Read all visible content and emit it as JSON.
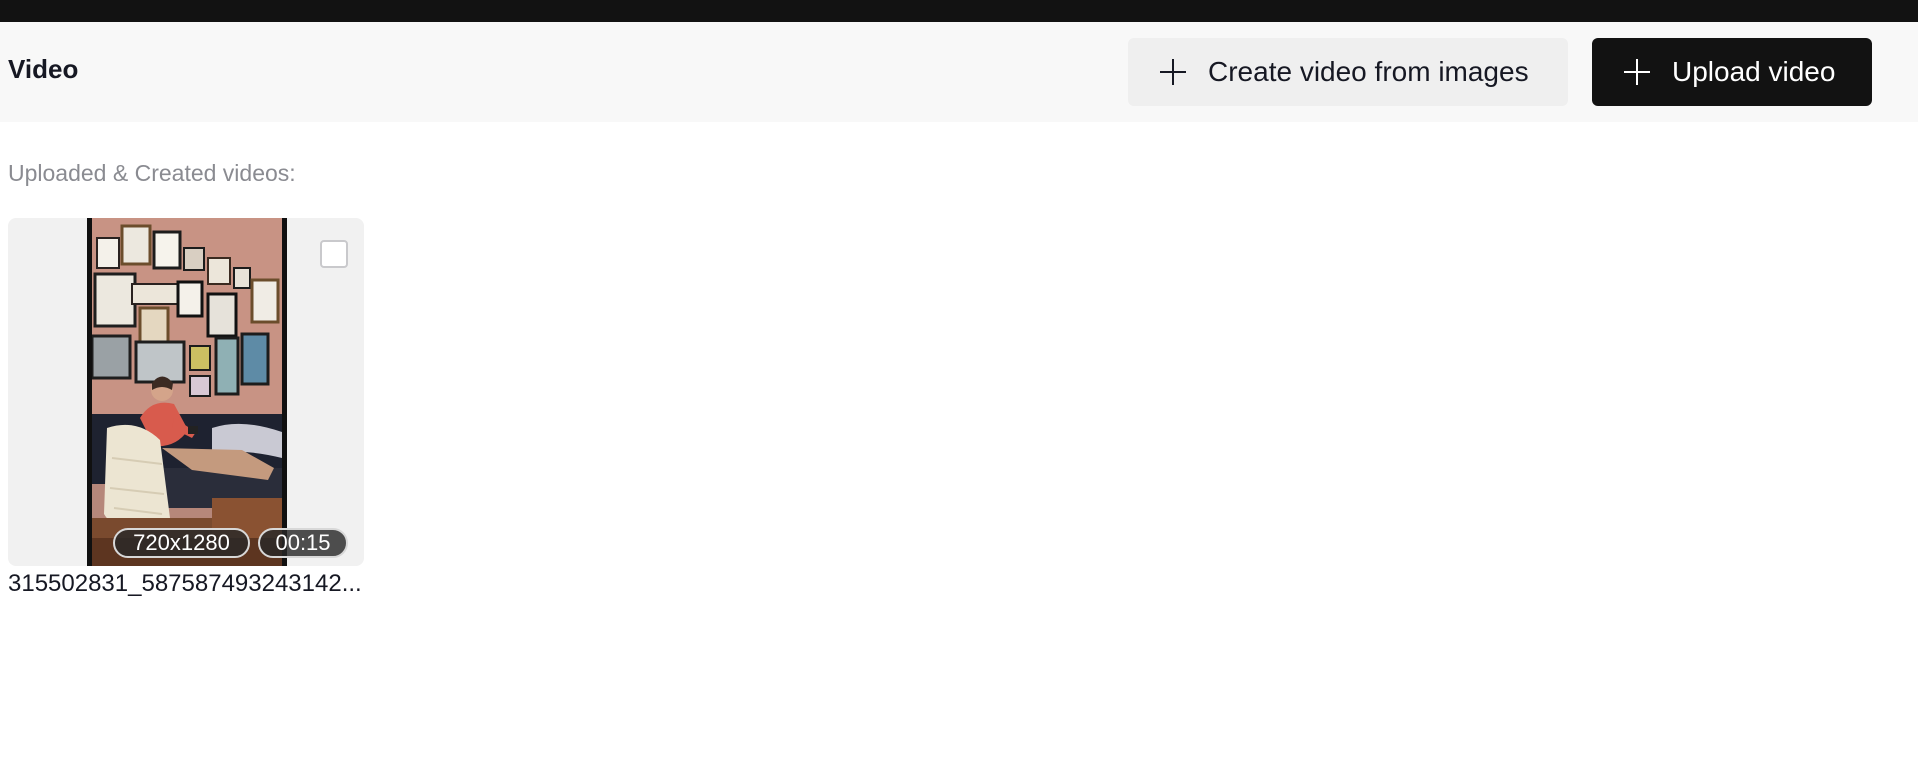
{
  "header": {
    "title": "Video",
    "create_button_label": "Create video from images",
    "upload_button_label": "Upload video"
  },
  "section": {
    "label": "Uploaded & Created videos:"
  },
  "videos": [
    {
      "resolution": "720x1280",
      "duration": "00:15",
      "filename": "315502831_587587493243142...",
      "selected": false
    }
  ],
  "colors": {
    "primary_button_bg": "#121212",
    "secondary_button_bg": "#efefef",
    "header_bg": "#f8f8f8",
    "muted_text": "#8a8b91"
  },
  "icons": {
    "create_button_icon": "plus-icon",
    "upload_button_icon": "plus-icon"
  }
}
